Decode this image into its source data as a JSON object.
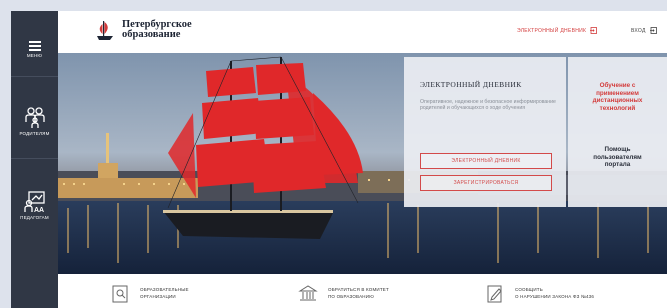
{
  "sidebar": {
    "items": [
      {
        "label": "МЕНЮ",
        "icon": "hamburger-icon"
      },
      {
        "label": "РОДИТЕЛЯМ",
        "icon": "parents-icon"
      },
      {
        "label": "ПЕДАГОГАМ",
        "icon": "teachers-icon"
      }
    ]
  },
  "header": {
    "logo_line1": "Петербургское",
    "logo_line2": "образование",
    "diary_link": "ЭЛЕКТРОННЫЙ ДНЕВНИК",
    "login_link": "ВХОД"
  },
  "diary_panel": {
    "title": "ЭЛЕКТРОННЫЙ ДНЕВНИК",
    "description": "Оперативное, надежное и безопасное информирование родителей и обучающихся о ходе обучения",
    "button_diary": "ЭЛЕКТРОННЫЙ ДНЕВНИК",
    "button_register": "ЗАРЕГИСТРИРОВАТЬСЯ"
  },
  "side_panel": {
    "distance_line1": "Обучение с",
    "distance_line2": "применением",
    "distance_line3": "дистанционных",
    "distance_line4": "технологий",
    "help_line1": "Помощь",
    "help_line2": "пользователям",
    "help_line3": "портала"
  },
  "bottom_links": [
    {
      "line1": "ОБРАЗОВАТЕЛЬНЫЕ",
      "line2": "ОРГАНИЗАЦИИ",
      "icon": "search-document-icon"
    },
    {
      "line1": "ОБРАТИТЬСЯ В КОМИТЕТ",
      "line2": "ПО ОБРАЗОВАНИЮ",
      "icon": "building-icon"
    },
    {
      "line1": "СООБЩИТЬ",
      "line2": "О НАРУШЕНИИ ЗАКОНА ФЗ №436",
      "icon": "report-icon"
    }
  ],
  "colors": {
    "sidebar_bg": "#303745",
    "accent_red": "#d33b3b",
    "sail_red": "#e0282a"
  }
}
